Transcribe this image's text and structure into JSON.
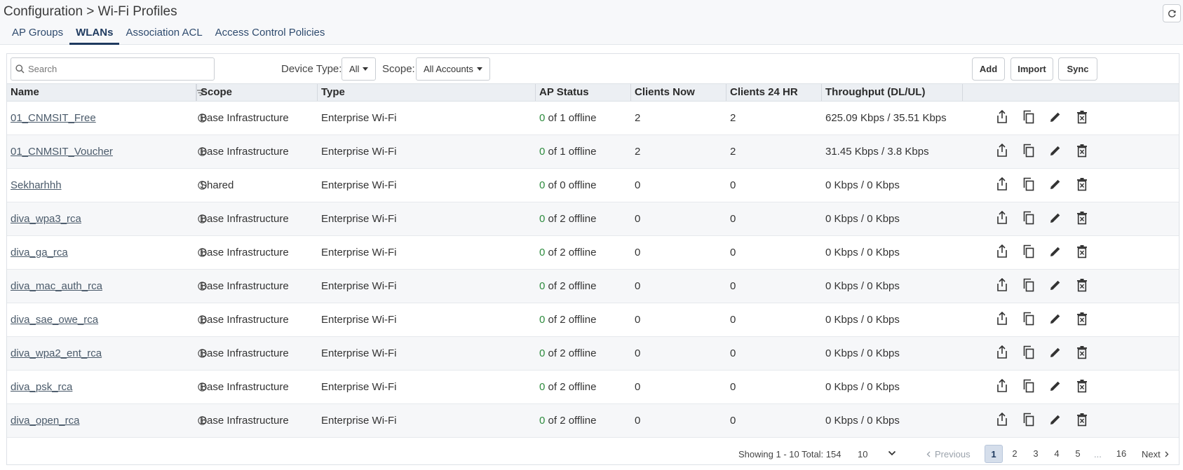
{
  "header": {
    "breadcrumb": "Configuration > Wi-Fi Profiles",
    "tabs": [
      {
        "label": "AP Groups",
        "active": false
      },
      {
        "label": "WLANs",
        "active": true
      },
      {
        "label": "Association ACL",
        "active": false
      },
      {
        "label": "Access Control Policies",
        "active": false
      }
    ]
  },
  "toolbar": {
    "search_placeholder": "Search",
    "device_type_label": "Device Type:",
    "device_type_value": "All",
    "scope_label": "Scope:",
    "scope_value": "All Accounts",
    "add_label": "Add",
    "import_label": "Import",
    "sync_label": "Sync"
  },
  "table": {
    "columns": [
      "Name",
      "Scope",
      "Type",
      "AP Status",
      "Clients Now",
      "Clients 24 HR",
      "Throughput (DL/UL)"
    ],
    "rows": [
      {
        "name": "01_CNMSIT_Free",
        "scope": "Base Infrastructure",
        "type": "Enterprise Wi-Fi",
        "ap_online": "0",
        "ap_rest": " of 1 offline",
        "clients_now": "2",
        "clients_24": "2",
        "throughput": "625.09 Kbps / 35.51 Kbps"
      },
      {
        "name": "01_CNMSIT_Voucher",
        "scope": "Base Infrastructure",
        "type": "Enterprise Wi-Fi",
        "ap_online": "0",
        "ap_rest": " of 1 offline",
        "clients_now": "2",
        "clients_24": "2",
        "throughput": "31.45 Kbps / 3.8 Kbps"
      },
      {
        "name": "Sekharhhh",
        "scope": "Shared",
        "type": "Enterprise Wi-Fi",
        "ap_online": "0",
        "ap_rest": " of 0 offline",
        "clients_now": "0",
        "clients_24": "0",
        "throughput": "0 Kbps / 0 Kbps"
      },
      {
        "name": "diva_wpa3_rca",
        "scope": "Base Infrastructure",
        "type": "Enterprise Wi-Fi",
        "ap_online": "0",
        "ap_rest": " of 2 offline",
        "clients_now": "0",
        "clients_24": "0",
        "throughput": "0 Kbps / 0 Kbps"
      },
      {
        "name": "diva_ga_rca",
        "scope": "Base Infrastructure",
        "type": "Enterprise Wi-Fi",
        "ap_online": "0",
        "ap_rest": " of 2 offline",
        "clients_now": "0",
        "clients_24": "0",
        "throughput": "0 Kbps / 0 Kbps"
      },
      {
        "name": "diva_mac_auth_rca",
        "scope": "Base Infrastructure",
        "type": "Enterprise Wi-Fi",
        "ap_online": "0",
        "ap_rest": " of 2 offline",
        "clients_now": "0",
        "clients_24": "0",
        "throughput": "0 Kbps / 0 Kbps"
      },
      {
        "name": "diva_sae_owe_rca",
        "scope": "Base Infrastructure",
        "type": "Enterprise Wi-Fi",
        "ap_online": "0",
        "ap_rest": " of 2 offline",
        "clients_now": "0",
        "clients_24": "0",
        "throughput": "0 Kbps / 0 Kbps"
      },
      {
        "name": "diva_wpa2_ent_rca",
        "scope": "Base Infrastructure",
        "type": "Enterprise Wi-Fi",
        "ap_online": "0",
        "ap_rest": " of 2 offline",
        "clients_now": "0",
        "clients_24": "0",
        "throughput": "0 Kbps / 0 Kbps"
      },
      {
        "name": "diva_psk_rca",
        "scope": "Base Infrastructure",
        "type": "Enterprise Wi-Fi",
        "ap_online": "0",
        "ap_rest": " of 2 offline",
        "clients_now": "0",
        "clients_24": "0",
        "throughput": "0 Kbps / 0 Kbps"
      },
      {
        "name": "diva_open_rca",
        "scope": "Base Infrastructure",
        "type": "Enterprise Wi-Fi",
        "ap_online": "0",
        "ap_rest": " of 2 offline",
        "clients_now": "0",
        "clients_24": "0",
        "throughput": "0 Kbps / 0 Kbps"
      }
    ],
    "row_actions": [
      "export-icon",
      "copy-icon",
      "edit-icon",
      "delete-icon"
    ]
  },
  "pagination": {
    "showing": "Showing 1 - 10 Total: 154",
    "page_size": "10",
    "previous_label": "Previous",
    "pages": [
      "1",
      "2",
      "3",
      "4",
      "5"
    ],
    "ellipsis": "...",
    "last_page": "16",
    "next_label": "Next",
    "current_page": "1"
  },
  "colors": {
    "accent": "#1f3a5f",
    "status_online": "#2e8b3e",
    "header_bg": "#eceff3"
  }
}
